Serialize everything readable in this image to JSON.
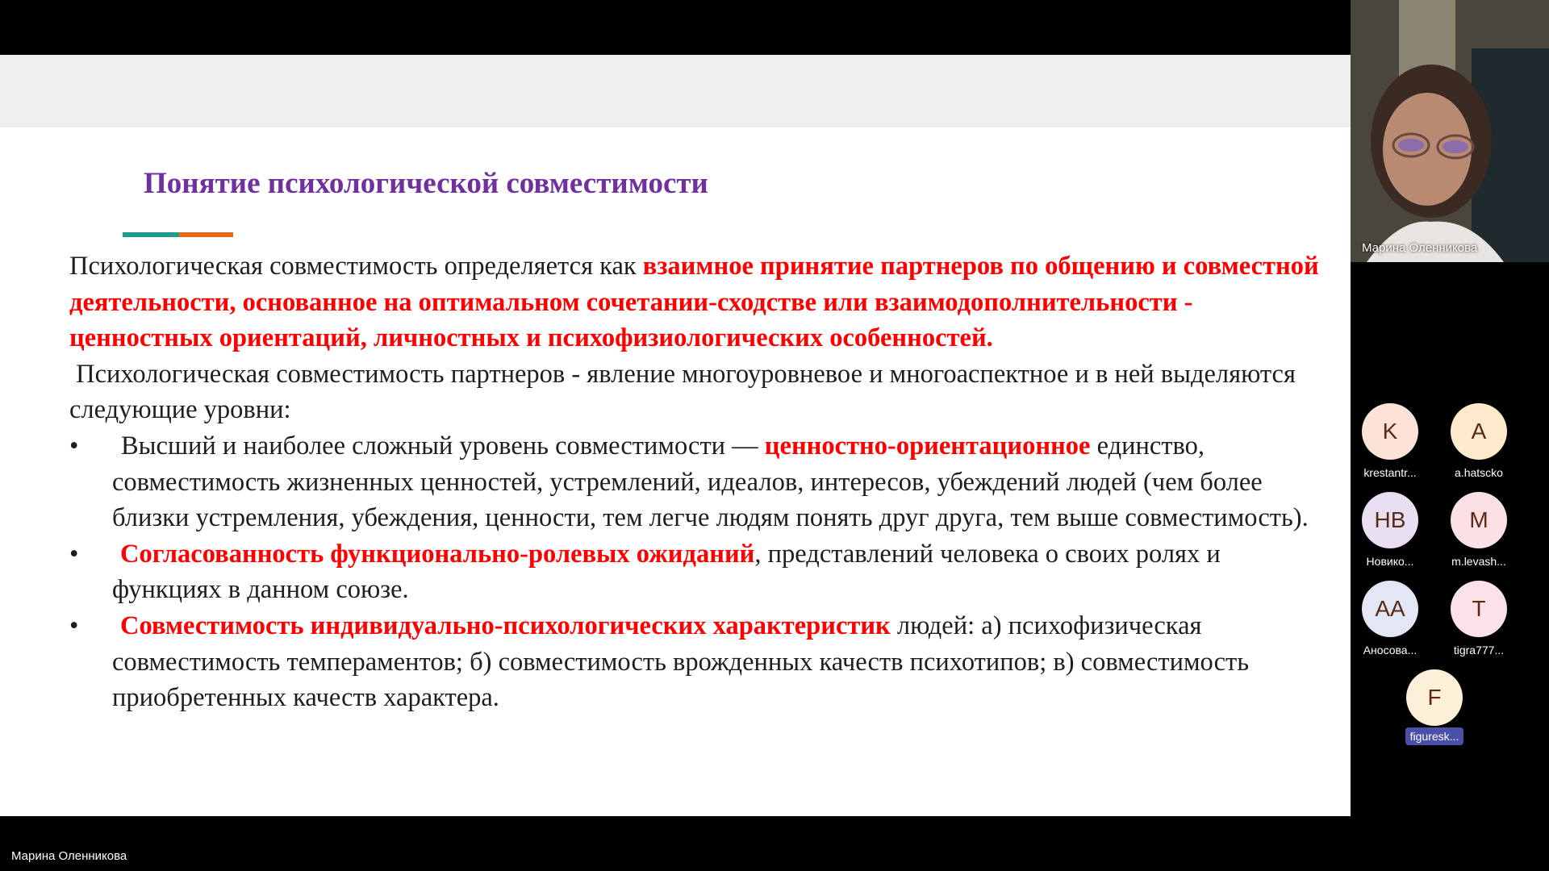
{
  "slide": {
    "title": "Понятие психологической совместимости",
    "para1_plain": "Психологическая совместимость определяется как ",
    "para1_red": "взаимное принятие партнеров по общению и совместной деятельности, основанное на оптимальном сочетании-сходстве или взаимодополнительности - ценностных ориентаций, личностных и психофизиологических особенностей.",
    "para2": "Психологическая совместимость партнеров - явление многоуровневое и многоаспектное и в ней выделяются следующие уровни:",
    "bullet_symbol": "•",
    "bullets": [
      {
        "plain_before": "Высший и наиболее сложный уровень совместимости — ",
        "red": "ценностно-ориентационное",
        "plain_after": " единство, совместимость жизненных ценностей, устремлений, идеалов, интересов, убеждений людей (чем более близки устремления, убеждения, ценности, тем легче людям понять друг друга, тем выше совместимость)."
      },
      {
        "plain_before": "",
        "red": "Согласованность функционально-ролевых ожиданий",
        "plain_after": ", представлений человека о своих ролях и функциях в данном союзе."
      },
      {
        "plain_before": "",
        "red": "Совместимость индивидуально-психологических характеристик",
        "plain_after": " людей: а) психофизическая совместимость темпераментов; б) совместимость врожденных качеств психотипов; в) совместимость приобретенных качеств характера."
      }
    ]
  },
  "video": {
    "speaker_name": "Марина Оленникова"
  },
  "participants": [
    {
      "initials": "K",
      "name": "krestantr...",
      "color": "#fde2d8"
    },
    {
      "initials": "A",
      "name": "a.hatscko",
      "color": "#fde9cc"
    },
    {
      "initials": "НВ",
      "name": "Новико...",
      "color": "#e8dff2"
    },
    {
      "initials": "M",
      "name": "m.levash...",
      "color": "#fbe1e6"
    },
    {
      "initials": "АА",
      "name": "Аносова...",
      "color": "#e2e6f5"
    },
    {
      "initials": "T",
      "name": "tigra777...",
      "color": "#fbe2e8"
    },
    {
      "initials": "F",
      "name": "figuresk...",
      "color": "#fdf0d8"
    }
  ],
  "bottom_bar": {
    "presenter_name": "Марина Оленникова"
  }
}
